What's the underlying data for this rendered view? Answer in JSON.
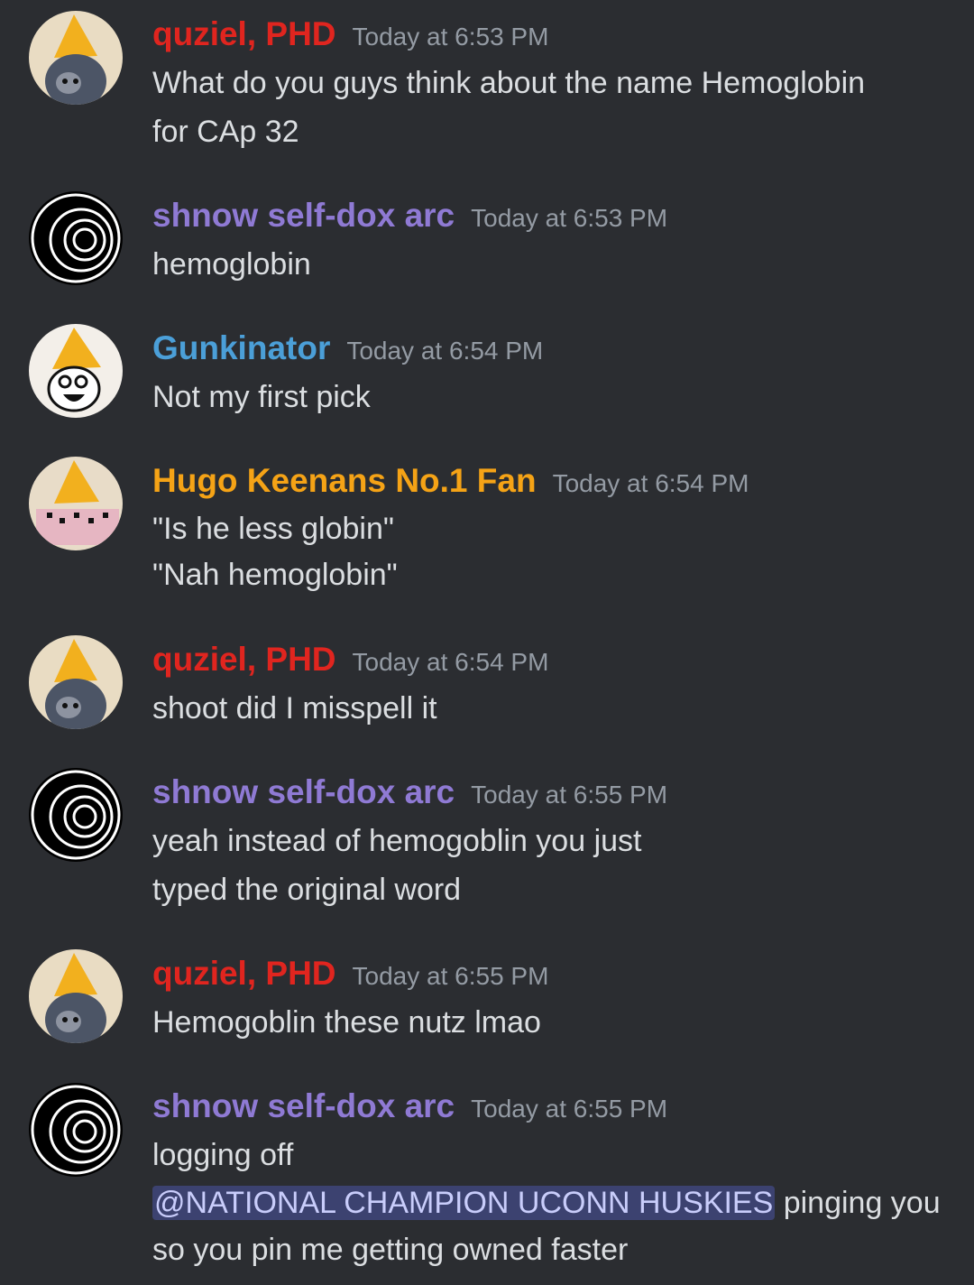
{
  "colors": {
    "background": "#2b2d31",
    "quziel": "#e0251f",
    "shnow": "#8f7ad4",
    "gunkinator": "#4b9fd8",
    "hugo": "#f5a316",
    "mention_bg": "#3c4270",
    "mention_text": "#c9cdfb"
  },
  "messages": [
    {
      "author": "quziel, PHD",
      "time": "Today at 6:53 PM",
      "lines": [
        "What do you guys think about the name Hemoglobin",
        "for CAp 32"
      ]
    },
    {
      "author": "shnow self-dox arc",
      "time": "Today at 6:53 PM",
      "lines": [
        "hemoglobin"
      ]
    },
    {
      "author": "Gunkinator",
      "time": "Today at 6:54 PM",
      "lines": [
        "Not my first pick"
      ]
    },
    {
      "author": "Hugo Keenans No.1 Fan",
      "time": "Today at 6:54 PM",
      "lines": [
        "\"Is he less globin\"",
        "\"Nah hemoglobin\""
      ]
    },
    {
      "author": "quziel, PHD",
      "time": "Today at 6:54 PM",
      "lines": [
        "shoot did I misspell it"
      ]
    },
    {
      "author": "shnow self-dox arc",
      "time": "Today at 6:55 PM",
      "lines": [
        "yeah instead of hemogoblin you just",
        "typed the original word"
      ]
    },
    {
      "author": "quziel, PHD",
      "time": "Today at 6:55 PM",
      "lines": [
        "Hemogoblin these nutz lmao"
      ]
    },
    {
      "author": "shnow self-dox arc",
      "time": "Today at 6:55 PM",
      "lines": [
        "logging off"
      ],
      "mention": "@NATIONAL CHAMPION UCONN HUSKIES",
      "mention_after": " pinging you",
      "last_line": "so you pin me getting owned faster"
    }
  ]
}
